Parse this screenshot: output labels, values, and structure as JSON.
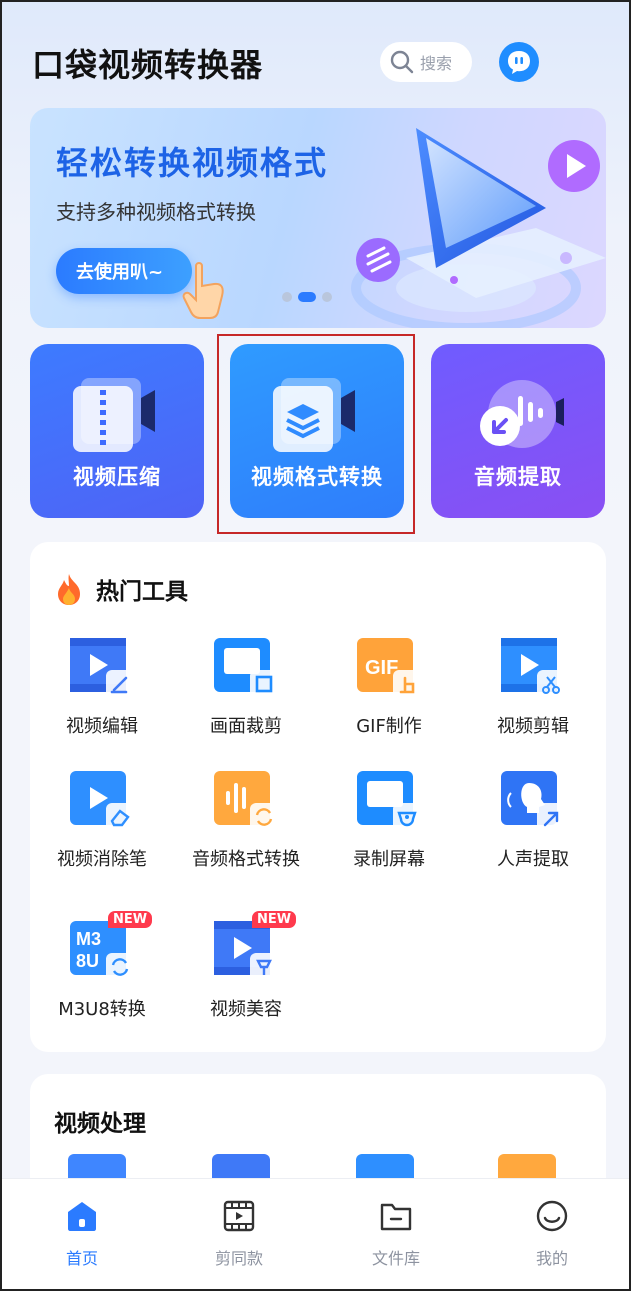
{
  "header": {
    "title": "口袋视频转换器",
    "search_placeholder": "搜索"
  },
  "banner": {
    "title": "轻松转换视频格式",
    "subtitle": "支持多种视频格式转换",
    "button_label": "去使用叭~",
    "page_index": 2,
    "page_count": 3
  },
  "features": [
    {
      "label": "视频压缩",
      "icon": "zip-video-icon"
    },
    {
      "label": "视频格式转换",
      "icon": "layers-video-icon"
    },
    {
      "label": "音频提取",
      "icon": "audio-extract-icon"
    }
  ],
  "hot_tools": {
    "title": "热门工具",
    "items": [
      {
        "label": "视频编辑",
        "icon": "video-edit-icon"
      },
      {
        "label": "画面裁剪",
        "icon": "crop-icon"
      },
      {
        "label": "GIF制作",
        "icon": "gif-icon"
      },
      {
        "label": "视频剪辑",
        "icon": "scissors-video-icon"
      },
      {
        "label": "视频消除笔",
        "icon": "eraser-video-icon"
      },
      {
        "label": "音频格式转换",
        "icon": "audio-convert-icon"
      },
      {
        "label": "录制屏幕",
        "icon": "screen-record-icon"
      },
      {
        "label": "人声提取",
        "icon": "voice-extract-icon"
      },
      {
        "label": "M3U8转换",
        "icon": "m3u8-icon",
        "badge": "NEW"
      },
      {
        "label": "视频美容",
        "icon": "beauty-video-icon",
        "badge": "NEW"
      }
    ]
  },
  "video_section": {
    "title": "视频处理"
  },
  "tabbar": {
    "items": [
      {
        "label": "首页",
        "active": true
      },
      {
        "label": "剪同款",
        "active": false
      },
      {
        "label": "文件库",
        "active": false
      },
      {
        "label": "我的",
        "active": false
      }
    ]
  },
  "colors": {
    "accent": "#2b7bff",
    "badge": "#ff3a4d",
    "highlight": "#c62828"
  }
}
